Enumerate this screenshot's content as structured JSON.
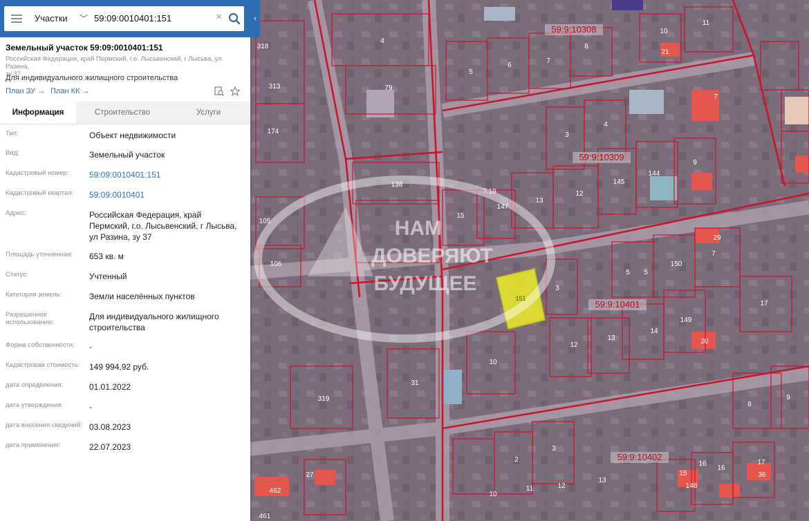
{
  "search": {
    "layer": "Участки",
    "query": "59:09:0010401:151"
  },
  "object": {
    "title": "Земельный участок 59:09:0010401:151",
    "address_line1": "Российская Федерация, край Пермский, г.о. Лысьвенский, г Лысьва, ул Разина,",
    "address_line2": "зу 37",
    "use": "Для индивидуального жилищного строительства",
    "plan_zu": "План ЗУ →",
    "plan_kk": "План КК →"
  },
  "tabs": [
    "Информация",
    "Строительство",
    "Услуги"
  ],
  "info": [
    {
      "label": "Тип:",
      "value": [
        "Объект недвижимости"
      ]
    },
    {
      "label": "Вид:",
      "value": [
        "Земельный участок"
      ]
    },
    {
      "label": "Кадастровый номер:",
      "value": [
        "59:09:0010401:151"
      ],
      "link": true
    },
    {
      "label": "Кадастровый квартал:",
      "value": [
        "59:09:0010401"
      ],
      "link": true
    },
    {
      "label": "Адрес:",
      "value": [
        "Российская Федерация, край",
        "Пермский, г.о. Лысьвенский, г Лысьва,",
        "ул Разина, зу 37"
      ]
    },
    {
      "label": "Площадь уточненная:",
      "value": [
        "653 кв. м"
      ]
    },
    {
      "label": "Статус:",
      "value": [
        "Учтенный"
      ]
    },
    {
      "label": "Категория земель:",
      "value": [
        "Земли населённых пунктов"
      ]
    },
    {
      "label": "Разрешенное использование:",
      "value": [
        "Для индивидуального жилищного",
        "строительства"
      ]
    },
    {
      "label": "Форма собственности:",
      "value": [
        "-"
      ]
    },
    {
      "label": "Кадастровая стоимость:",
      "value": [
        "149 994,92 руб."
      ]
    },
    {
      "label": "дата определения:",
      "value": [
        "01.01.2022"
      ]
    },
    {
      "label": "дата утверждения:",
      "value": [
        "-"
      ]
    },
    {
      "label": "дата внесения сведений:",
      "value": [
        "03.08.2023"
      ]
    },
    {
      "label": "дата применения:",
      "value": [
        "22.07.2023"
      ]
    }
  ],
  "map": {
    "quarters": [
      "59:9:10308",
      "59:9:10309",
      "59:9:10401",
      "59:9:10402"
    ],
    "selected_parcel": "151",
    "watermark": [
      "НАМ",
      "ДОВЕРЯЮТ",
      "БУДУЩЕЕ"
    ],
    "parcel_numbers": [
      "4",
      "79",
      "5",
      "6",
      "7",
      "8",
      "10",
      "11",
      "21",
      "3",
      "4",
      "7",
      "144",
      "145",
      "9",
      "13",
      "12",
      "147",
      "15",
      "138",
      "105",
      "106",
      "313",
      "318",
      "174",
      "7.19",
      "5",
      "5",
      "150",
      "29",
      "7",
      "3",
      "149",
      "14",
      "13",
      "12",
      "10",
      "20",
      "17",
      "31",
      "319",
      "2",
      "3",
      "12",
      "13",
      "11",
      "10",
      "462",
      "461",
      "27",
      "16",
      "15",
      "148",
      "36",
      "17",
      "9",
      "8",
      "16"
    ]
  },
  "colors": {
    "accent": "#2e6db4",
    "link": "#2a73c6",
    "boundary": "#c4182c",
    "selected": "#e6e62e"
  }
}
